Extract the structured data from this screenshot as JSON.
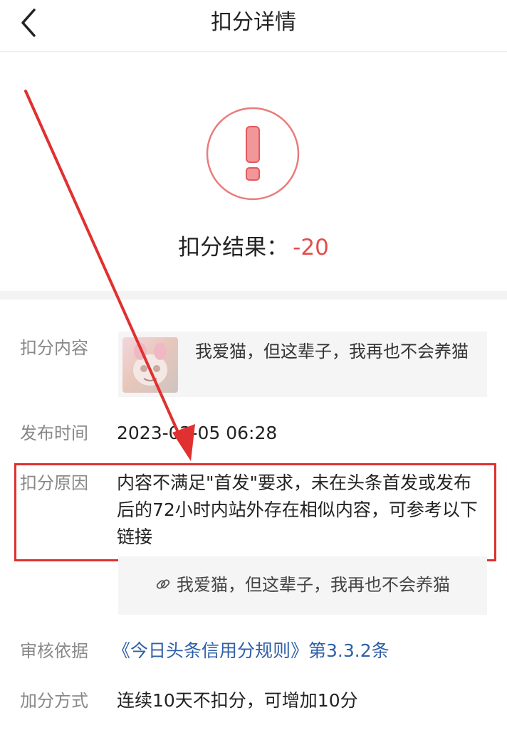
{
  "header": {
    "title": "扣分详情",
    "back_icon": "chevron-left-icon"
  },
  "result": {
    "label": "扣分结果：",
    "value": "-20",
    "icon": "exclamation-circle-icon",
    "accent": "#e34d4d"
  },
  "details": {
    "content_label": "扣分内容",
    "content_text": "我爱猫，但这辈子，我再也不会养猫",
    "publish_label": "发布时间",
    "publish_time": "2023-02-05 06:28",
    "reason_label": "扣分原因",
    "reason_text": "内容不满足\"首发\"要求，未在头条首发或发布后的72小时内站外存在相似内容，可参考以下链接",
    "link_text": "我爱猫，但这辈子，我再也不会养猫",
    "link_icon": "link-icon",
    "basis_label": "审核依据",
    "basis_text": "《今日头条信用分规则》第3.3.2条",
    "bonus_label": "加分方式",
    "bonus_text": "连续10天不扣分，可增加10分"
  },
  "annotation": {
    "color": "#e03030"
  }
}
